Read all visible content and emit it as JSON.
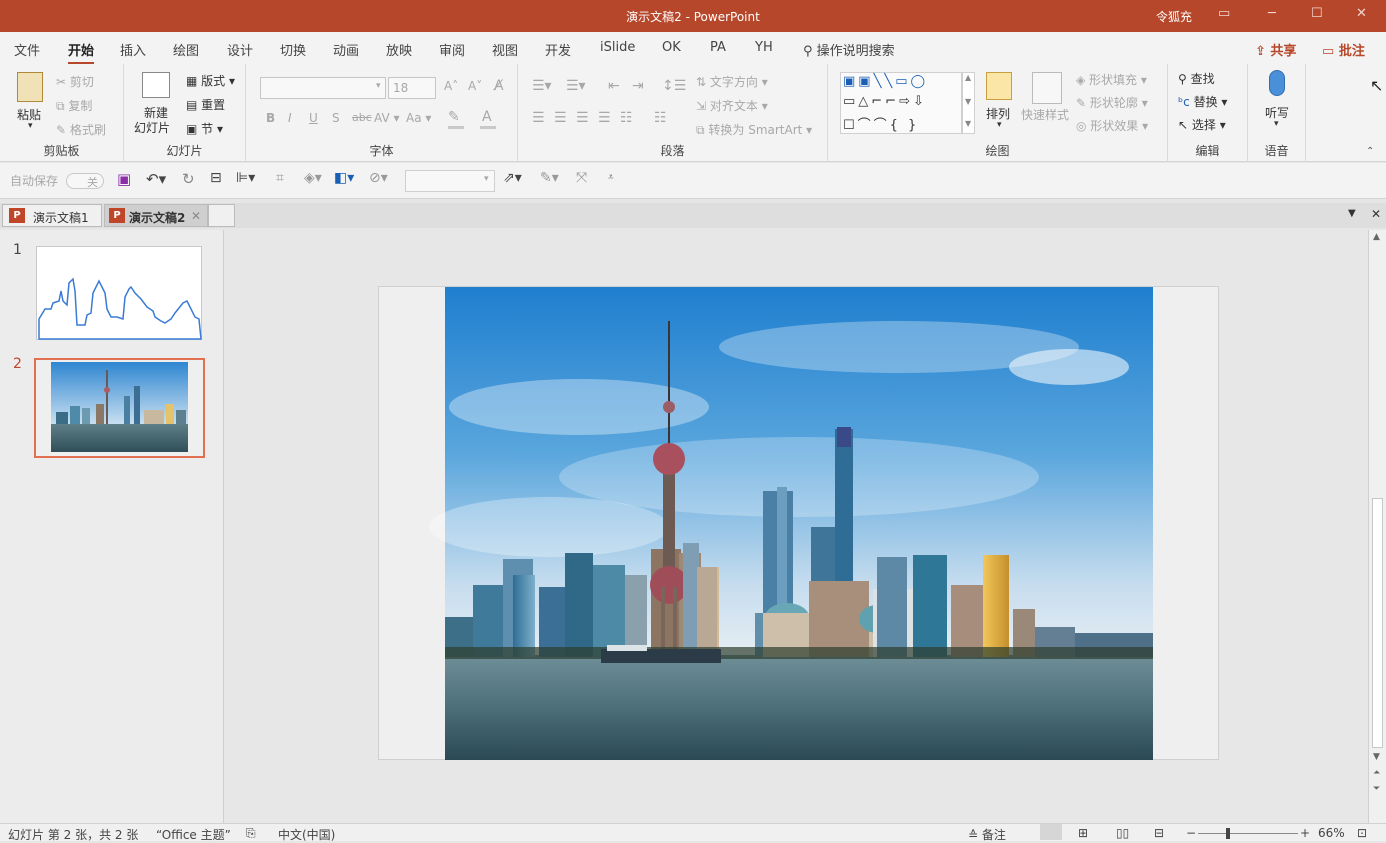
{
  "window": {
    "title": "演示文稿2  -  PowerPoint",
    "user": "令狐充"
  },
  "ribbon_tabs": [
    "文件",
    "开始",
    "插入",
    "绘图",
    "设计",
    "切换",
    "动画",
    "放映",
    "审阅",
    "视图",
    "开发",
    "iSlide",
    "OK",
    "PA",
    "YH"
  ],
  "search": {
    "label": "操作说明搜索"
  },
  "share_label": "共享",
  "comment_label": "批注",
  "clipboard": {
    "paste": "粘贴",
    "cut": "剪切",
    "copy": "复制",
    "format_painter": "格式刷",
    "group": "剪贴板"
  },
  "slides_group": {
    "new_slide_1": "新建",
    "new_slide_2": "幻灯片",
    "layout": "版式",
    "reset": "重置",
    "section": "节",
    "group": "幻灯片"
  },
  "font_group": {
    "font_size": "18",
    "group": "字体",
    "bold": "B",
    "italic": "I",
    "underline": "U",
    "shadow": "S",
    "strike": "abc",
    "spacing": "AV",
    "case": "Aa"
  },
  "paragraph_group": {
    "text_direction": "文字方向",
    "align_text": "对齐文本",
    "smartart": "转换为 SmartArt",
    "group": "段落"
  },
  "drawing_group": {
    "arrange": "排列",
    "quick_styles": "快速样式",
    "shape_fill": "形状填充",
    "shape_outline": "形状轮廓",
    "shape_effects": "形状效果",
    "group": "绘图"
  },
  "editing_group": {
    "find": "查找",
    "replace": "替换",
    "select": "选择",
    "group": "编辑"
  },
  "voice_group": {
    "dictate": "听写",
    "group": "语音"
  },
  "qat": {
    "autosave": "自动保存",
    "autosave_state": "关"
  },
  "doc_tabs": [
    {
      "label": "演示文稿1",
      "selected": false
    },
    {
      "label": "演示文稿2",
      "selected": true
    }
  ],
  "slides": [
    {
      "number": "1"
    },
    {
      "number": "2",
      "selected": true
    }
  ],
  "status": {
    "slide_info": "幻灯片 第 2 张，共 2 张",
    "theme": "“Office 主题”",
    "language": "中文(中国)",
    "notes": "备注",
    "zoom": "66%"
  },
  "colors": {
    "accent": "#b7472a",
    "selection": "#e07050",
    "outline_stroke": "#3a7bd5"
  }
}
